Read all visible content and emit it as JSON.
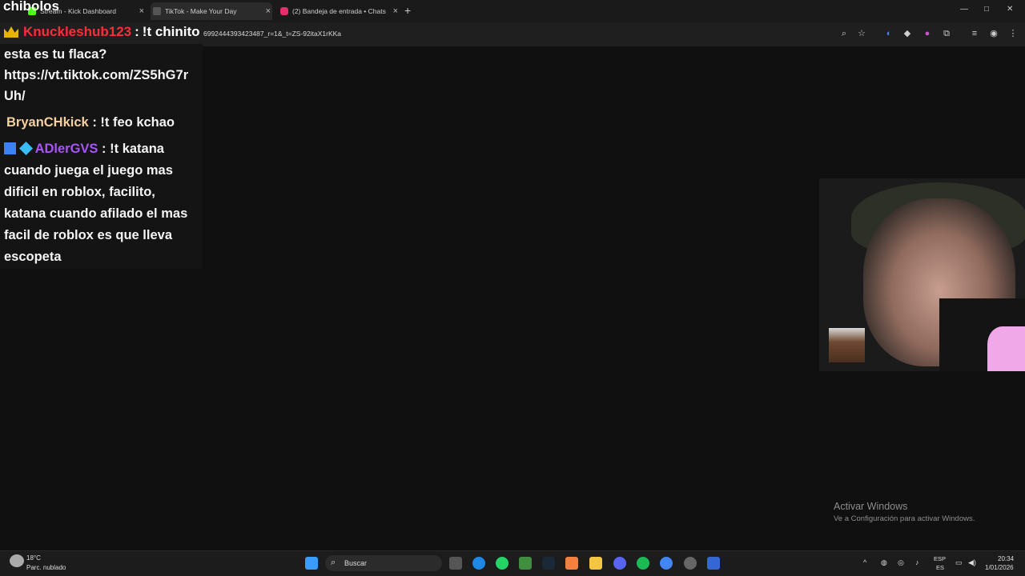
{
  "tabs": [
    {
      "label": "Stream - Kick Dashboard"
    },
    {
      "label": "TikTok - Make Your Day"
    },
    {
      "label": "(2) Bandeja de entrada • Chats"
    }
  ],
  "address_bar": {
    "url": "6992444393423487_r=1&_t=ZS-92itaX1rKKa"
  },
  "overlay": {
    "title": "chibolos",
    "top_user": "Knuckleshub123",
    "top_text": "!t chinito",
    "colon": ":"
  },
  "chat": {
    "lines": [
      {
        "text": "esta es tu flaca?"
      },
      {
        "text": "https://vt.tiktok.com/ZS5hG7r"
      },
      {
        "text": "Uh/"
      }
    ],
    "messages": [
      {
        "user": "BryanCHkick",
        "text": "!t feo kchao"
      },
      {
        "user": "ADlerGVS",
        "text": "!t katana"
      }
    ],
    "continuation": [
      "cuando juega el juego mas",
      "dificil en roblox, facilito,",
      "katana cuando afilado el mas",
      "facil de roblox es que lleva",
      "escopeta"
    ]
  },
  "watermark": {
    "title": "Activar Windows",
    "subtitle": "Ve a Configuración para activar Windows."
  },
  "taskbar": {
    "weather_temp": "18°C",
    "weather_desc": "Parc. nublado",
    "search_placeholder": "Buscar",
    "lang_top": "ESP",
    "lang_bottom": "ES",
    "time": "20:34",
    "date": "1/01/2026"
  },
  "colors": {
    "accent_red": "#ff2d3a",
    "accent_violet": "#a855f7",
    "accent_tan": "#f5d0a0"
  }
}
